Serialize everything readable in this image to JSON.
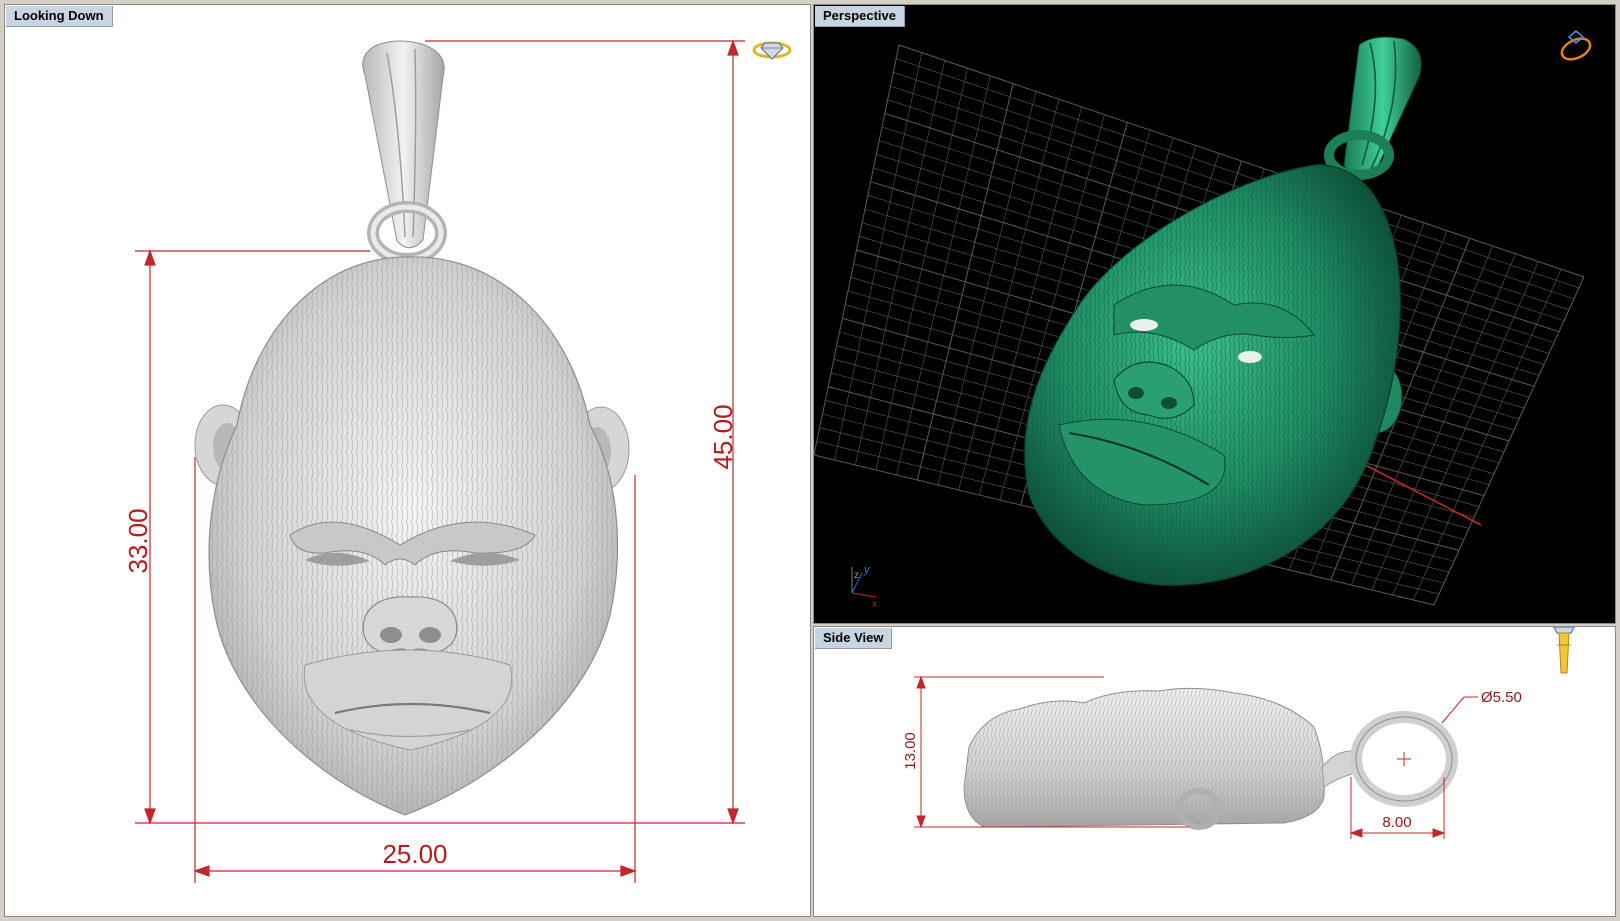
{
  "viewports": {
    "top": {
      "label": "Looking Down"
    },
    "perspective": {
      "label": "Perspective"
    },
    "side": {
      "label": "Side View"
    }
  },
  "dimensions": {
    "top": {
      "total_height": "45.00",
      "head_height": "33.00",
      "width": "25.00"
    },
    "side": {
      "thickness": "13.00",
      "bail_diameter": "Ø5.50",
      "bail_width": "8.00"
    }
  },
  "axes": {
    "y": "y",
    "z": "z",
    "x": "x"
  },
  "icons": {
    "top_view": "gem-ring-icon",
    "perspective": "ring-icon",
    "side": "pendant-icon"
  },
  "colors": {
    "dimension_line": "#c0282d",
    "model_perspective": "#1f8a62",
    "model_render": "#dcdcdc",
    "grid": "#5a5a5a"
  }
}
